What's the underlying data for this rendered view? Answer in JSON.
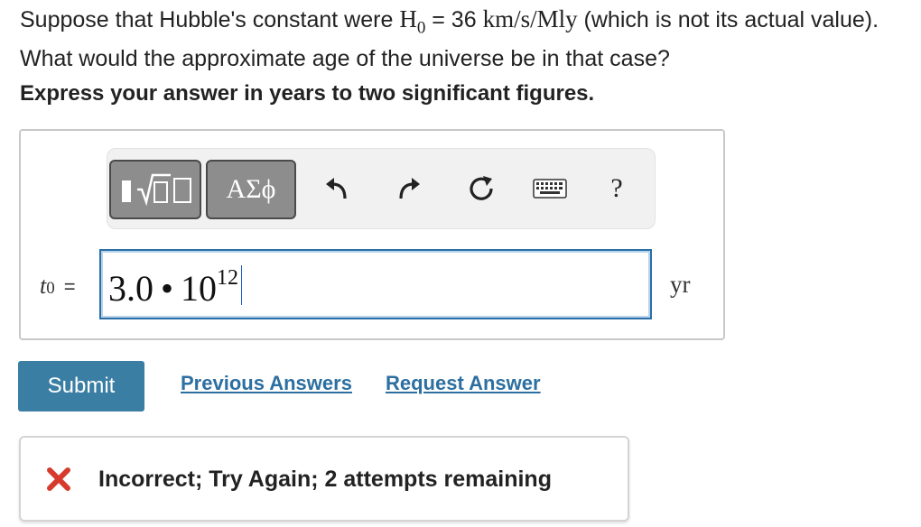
{
  "question": {
    "text_before": "Suppose that Hubble's constant were ",
    "h0_symbol": "H",
    "h0_subscript": "0",
    "equals": " = 36 ",
    "units": "km/s/Mly",
    "text_after": " (which is not its actual value). What would the approximate age of the universe be in that case?"
  },
  "instruction": "Express your answer in years to two significant figures.",
  "toolbar": {
    "greek_label": "ΑΣϕ",
    "help_label": "?",
    "icons": [
      "templates-icon",
      "undo-icon",
      "redo-icon",
      "reset-icon",
      "keyboard-icon",
      "help-icon"
    ]
  },
  "answer": {
    "variable": "t",
    "variable_subscript": "0",
    "equals": "=",
    "mantissa": "3.0",
    "times": "•",
    "base": "10",
    "exponent": "12",
    "unit": "yr"
  },
  "actions": {
    "submit_label": "Submit",
    "previous_answers_label": "Previous Answers",
    "request_answer_label": "Request Answer"
  },
  "feedback": {
    "message": "Incorrect; Try Again; 2 attempts remaining",
    "icon": "x-mark-icon",
    "icon_color": "#d63a2d"
  },
  "colors": {
    "submit_bg": "#3b7ea4",
    "link": "#2c6fa0",
    "input_border": "#2a6fa8"
  }
}
